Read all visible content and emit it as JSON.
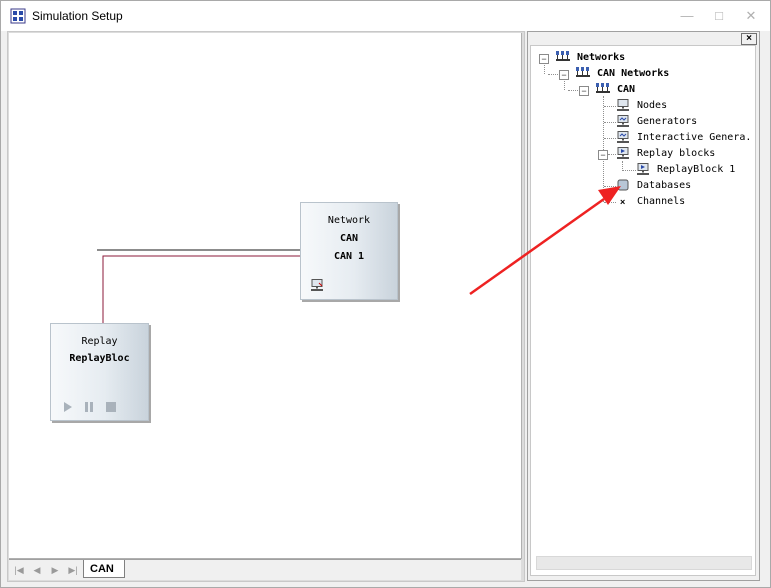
{
  "window": {
    "title": "Simulation Setup",
    "minimize_glyph": "—",
    "maximize_glyph": "□",
    "close_glyph": "✕"
  },
  "canvas": {
    "network_block": {
      "type_label": "Network",
      "line1": "CAN",
      "line2": "CAN 1"
    },
    "replay_block": {
      "type_label": "Replay",
      "line1": "ReplayBloc"
    },
    "tabs": [
      {
        "label": "CAN"
      }
    ],
    "nav_glyphs": {
      "first": "|◀",
      "prev": "◀",
      "next": "▶",
      "last": "▶|"
    },
    "bus_line_colors": {
      "network": "#000000",
      "replay": "#8b1a3a"
    }
  },
  "panel": {
    "close_glyph": "×",
    "tree": [
      {
        "label": "Networks",
        "icon": "network-icon",
        "level": 0,
        "expanded": true
      },
      {
        "label": "CAN Networks",
        "icon": "network-icon",
        "level": 1,
        "expanded": true
      },
      {
        "label": "CAN",
        "icon": "network-icon",
        "level": 2,
        "expanded": true
      },
      {
        "label": "Nodes",
        "icon": "node-icon",
        "level": 3
      },
      {
        "label": "Generators",
        "icon": "generator-icon",
        "level": 3
      },
      {
        "label": "Interactive Genera.",
        "icon": "generator-icon",
        "level": 3
      },
      {
        "label": "Replay blocks",
        "icon": "replay-icon",
        "level": 3,
        "expanded": true
      },
      {
        "label": "ReplayBlock 1",
        "icon": "replay-icon",
        "level": 4
      },
      {
        "label": "Databases",
        "icon": "database-icon",
        "level": 3
      },
      {
        "label": "Channels",
        "icon": "channel-icon",
        "level": 3
      }
    ]
  },
  "annotation": {
    "arrow_color": "#ee2222"
  }
}
